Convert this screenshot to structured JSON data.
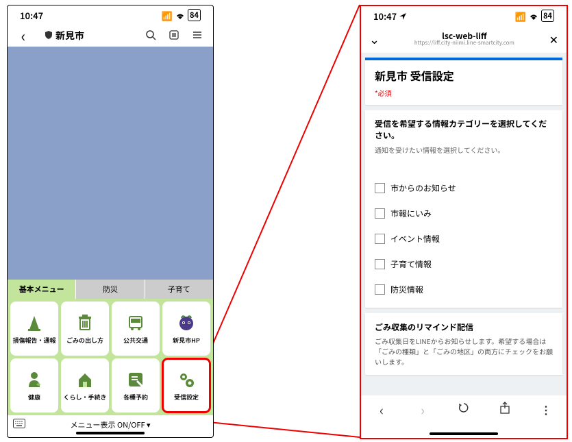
{
  "status": {
    "time": "10:47",
    "battery": "84"
  },
  "left": {
    "header": {
      "back": "‹",
      "shield": "◈",
      "title": "新見市",
      "icons": {
        "search": "⌕",
        "list": "▤",
        "menu": "≡"
      }
    },
    "tabs": [
      "基本メニュー",
      "防災",
      "子育て"
    ],
    "grid": [
      {
        "label": "損傷報告・通報"
      },
      {
        "label": "ごみの出し方"
      },
      {
        "label": "公共交通"
      },
      {
        "label": "新見市HP"
      },
      {
        "label": "健康"
      },
      {
        "label": "くらし・手続き"
      },
      {
        "label": "各種予約"
      },
      {
        "label": "受信設定"
      }
    ],
    "bottom": "メニュー表示 ON/OFF ▾",
    "keyboard": "⌨"
  },
  "right": {
    "header": {
      "chevron": "⌄",
      "title": "lsc-web-liff",
      "url": "https://liff.city-niimi.line-smartcity.com",
      "close": "✕"
    },
    "card1": {
      "title": "新見市 受信設定",
      "required": "*必須"
    },
    "card2": {
      "title": "受信を希望する情報カテゴリーを選択してください。",
      "sub": "通知を受けたい情報を選択してください。",
      "options": [
        "市からのお知らせ",
        "市報にいみ",
        "イベント情報",
        "子育て情報",
        "防災情報"
      ]
    },
    "card3": {
      "title": "ごみ収集のリマインド配信",
      "desc": "ごみ収集日をLINEからお知らせします。希望する場合は「ごみの種類」と「ごみの地区」の両方にチェックをお願いします。"
    },
    "nav": {
      "back": "‹",
      "fwd": "›",
      "reload": "↻",
      "share": "⇧",
      "more": "⋮"
    }
  }
}
